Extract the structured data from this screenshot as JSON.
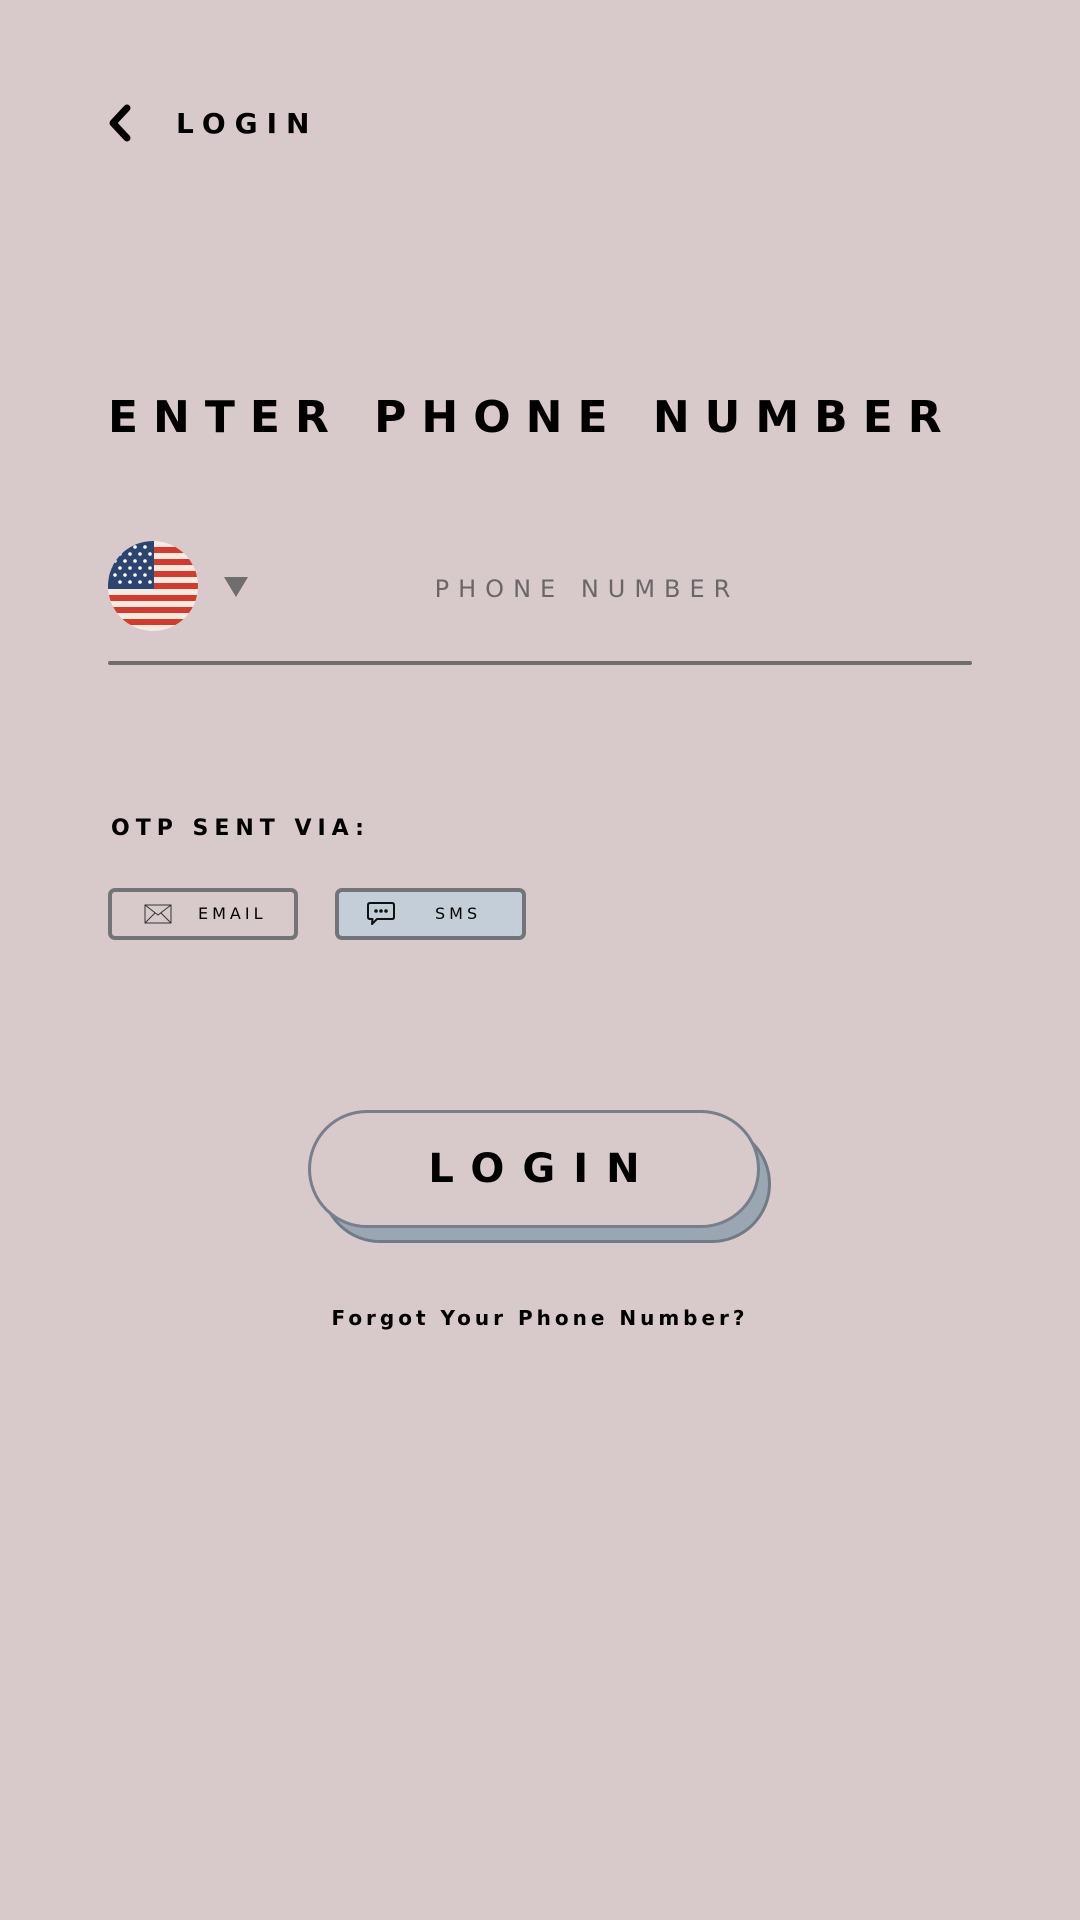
{
  "header": {
    "title": "LOGIN"
  },
  "main": {
    "title": "ENTER PHONE NUMBER",
    "phone": {
      "country_flag_icon": "us-flag-icon",
      "dropdown_icon": "caret-down-icon",
      "placeholder": "PHONE NUMBER",
      "value": ""
    },
    "otp": {
      "label": "OTP SENT VIA:",
      "options": [
        {
          "label": "EMAIL",
          "icon": "envelope-icon",
          "selected": false
        },
        {
          "label": "SMS",
          "icon": "chat-bubble-icon",
          "selected": true
        }
      ]
    },
    "login_button_label": "LOGIN",
    "forgot_link": "Forgot Your Phone Number?"
  },
  "colors": {
    "background": "#d8cacb",
    "selected_option": "#c4ced8",
    "button_shadow": "#9ba6b3",
    "border": "#727478"
  }
}
